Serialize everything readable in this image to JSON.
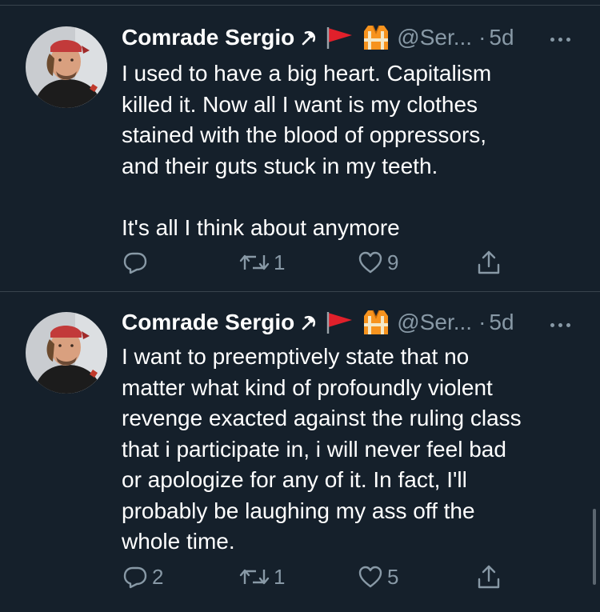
{
  "feed": {
    "tweets": [
      {
        "author_name": "Comrade Sergio",
        "author_emojis": [
          "hammer-sickle-icon",
          "red-flag-icon",
          "safety-vest-icon"
        ],
        "handle": "@Ser...",
        "separator": "·",
        "time": "5d",
        "text": "I used to have a big heart. Capitalism\nkilled it. Now all I want is my clothes\nstained with the blood of oppressors,\nand their guts stuck in my teeth.\n\nIt's all I think about anymore",
        "reply_count": "",
        "retweet_count": "1",
        "like_count": "9"
      },
      {
        "author_name": "Comrade Sergio",
        "author_emojis": [
          "hammer-sickle-icon",
          "red-flag-icon",
          "safety-vest-icon"
        ],
        "handle": "@Ser...",
        "separator": "·",
        "time": "5d",
        "text": "I want to preemptively state that no\nmatter what kind of profoundly violent\nrevenge exacted against the ruling class\nthat i participate in, i will never feel bad\nor apologize for any of it. In fact, I'll\nprobably be laughing my ass off the\nwhole time.",
        "reply_count": "2",
        "retweet_count": "1",
        "like_count": "5"
      }
    ]
  },
  "colors": {
    "background": "#15202b",
    "divider": "#38444d",
    "secondary_text": "#8899a6",
    "primary_text": "#ffffff",
    "flag_red": "#e0202b",
    "vest_orange": "#f7931e"
  }
}
